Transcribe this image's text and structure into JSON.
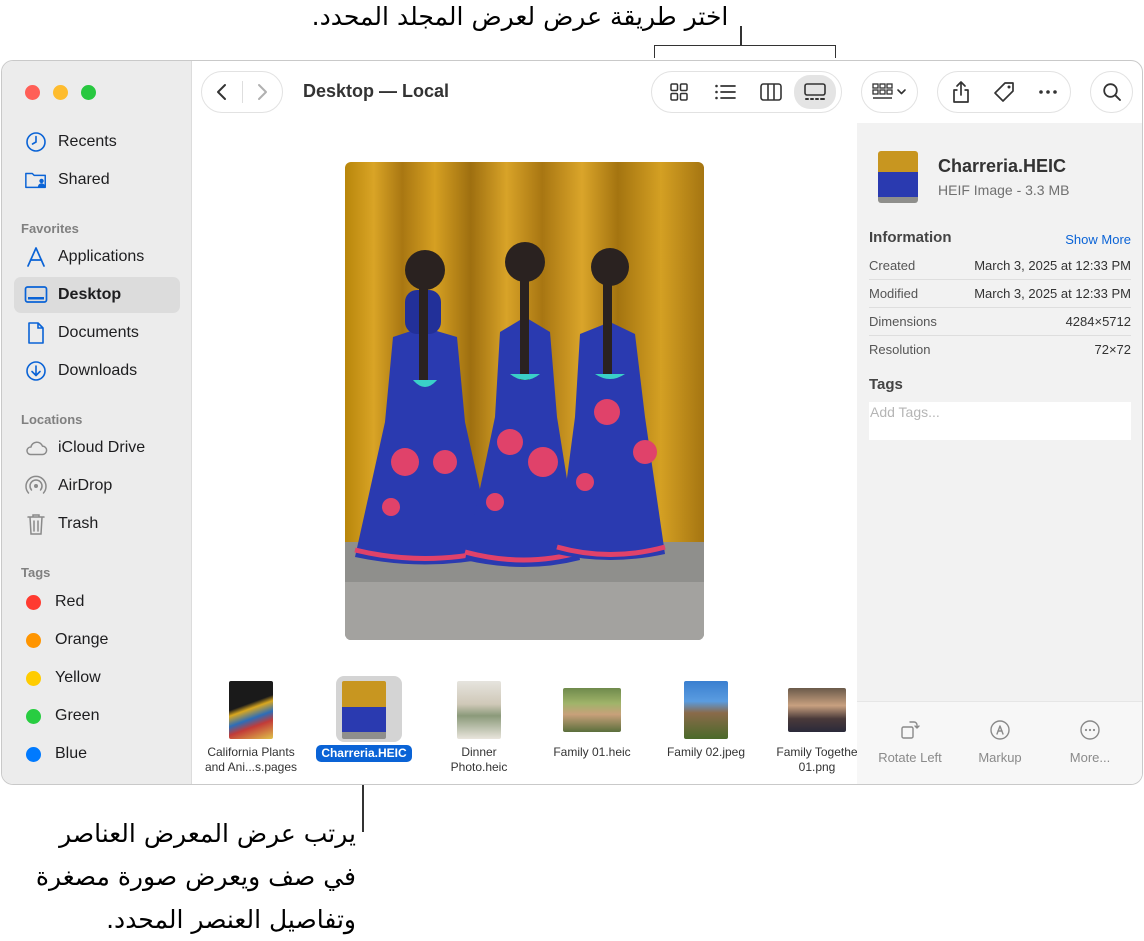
{
  "callouts": {
    "top": "اختر طريقة عرض لعرض المجلد المحدد.",
    "bottom_line1": "يرتب عرض المعرض العناصر",
    "bottom_line2": "في صف ويعرض صورة مصغرة",
    "bottom_line3": "وتفاصيل العنصر المحدد."
  },
  "window": {
    "title": "Desktop — Local"
  },
  "sidebar": {
    "items_top": [
      {
        "label": "Recents",
        "icon": "clock-icon"
      },
      {
        "label": "Shared",
        "icon": "shared-folder-icon"
      }
    ],
    "favorites_title": "Favorites",
    "favorites": [
      {
        "label": "Applications",
        "icon": "applications-icon"
      },
      {
        "label": "Desktop",
        "icon": "desktop-icon",
        "selected": true
      },
      {
        "label": "Documents",
        "icon": "document-icon"
      },
      {
        "label": "Downloads",
        "icon": "download-icon"
      }
    ],
    "locations_title": "Locations",
    "locations": [
      {
        "label": "iCloud Drive",
        "icon": "cloud-icon"
      },
      {
        "label": "AirDrop",
        "icon": "airdrop-icon"
      },
      {
        "label": "Trash",
        "icon": "trash-icon"
      }
    ],
    "tags_title": "Tags",
    "tags": [
      {
        "label": "Red",
        "color": "#ff3b30"
      },
      {
        "label": "Orange",
        "color": "#ff9500"
      },
      {
        "label": "Yellow",
        "color": "#ffcc00"
      },
      {
        "label": "Green",
        "color": "#28cd41"
      },
      {
        "label": "Blue",
        "color": "#007aff"
      }
    ]
  },
  "gallery": [
    {
      "line1": "California Plants",
      "line2": "and Ani...s.pages",
      "selected": false
    },
    {
      "line1": "Charreria.HEIC",
      "line2": "",
      "selected": true
    },
    {
      "line1": "Dinner",
      "line2": "Photo.heic",
      "selected": false
    },
    {
      "line1": "Family 01.heic",
      "line2": "",
      "selected": false
    },
    {
      "line1": "Family 02.jpeg",
      "line2": "",
      "selected": false
    },
    {
      "line1": "Family Togethe",
      "line2": "01.png",
      "selected": false
    }
  ],
  "inspector": {
    "name": "Charreria.HEIC",
    "kind": "HEIF Image - 3.3 MB",
    "info_title": "Information",
    "show_more": "Show More",
    "rows": [
      {
        "key": "Created",
        "value": "March 3, 2025 at 12:33 PM"
      },
      {
        "key": "Modified",
        "value": "March 3, 2025 at 12:33 PM"
      },
      {
        "key": "Dimensions",
        "value": "4284×5712"
      },
      {
        "key": "Resolution",
        "value": "72×72"
      }
    ],
    "tags_title": "Tags",
    "tags_placeholder": "Add Tags...",
    "actions": [
      {
        "label": "Rotate Left",
        "icon": "rotate-left-icon"
      },
      {
        "label": "Markup",
        "icon": "markup-icon"
      },
      {
        "label": "More...",
        "icon": "more-icon"
      }
    ]
  },
  "colors": {
    "accent": "#0a63d6",
    "sidebar_bg": "#ececec",
    "inspector_bg": "#f2f2f2"
  }
}
